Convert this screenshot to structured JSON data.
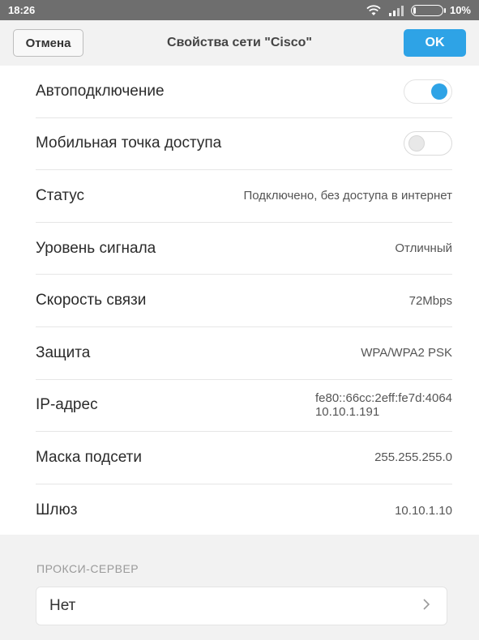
{
  "status_bar": {
    "time": "18:26",
    "battery_percent_label": "10%",
    "battery_level": 0.1,
    "icons": [
      "wifi-icon",
      "signal-icon",
      "battery-icon"
    ]
  },
  "header": {
    "cancel_label": "Отмена",
    "title": "Свойства сети \"Cisco\"",
    "ok_label": "OK",
    "accent_color": "#2ea3e6"
  },
  "settings": {
    "auto_connect": {
      "label": "Автоподключение",
      "enabled": true
    },
    "mobile_hotspot": {
      "label": "Мобильная точка доступа",
      "enabled": false
    },
    "status": {
      "label": "Статус",
      "value": "Подключено, без доступа в интернет"
    },
    "signal": {
      "label": "Уровень сигнала",
      "value": "Отличный"
    },
    "speed": {
      "label": "Скорость связи",
      "value": "72Mbps"
    },
    "security": {
      "label": "Защита",
      "value": "WPA/WPA2 PSK"
    },
    "ip": {
      "label": "IP-адрес",
      "value_ipv6": "fe80::66cc:2eff:fe7d:4064",
      "value_ipv4": "10.10.1.191"
    },
    "subnet": {
      "label": "Маска подсети",
      "value": "255.255.255.0"
    },
    "gateway": {
      "label": "Шлюз",
      "value": "10.10.1.10"
    }
  },
  "proxy": {
    "section_title": "ПРОКСИ-СЕРВЕР",
    "selected": "Нет",
    "chevron_icon": "chevron-right-icon"
  }
}
